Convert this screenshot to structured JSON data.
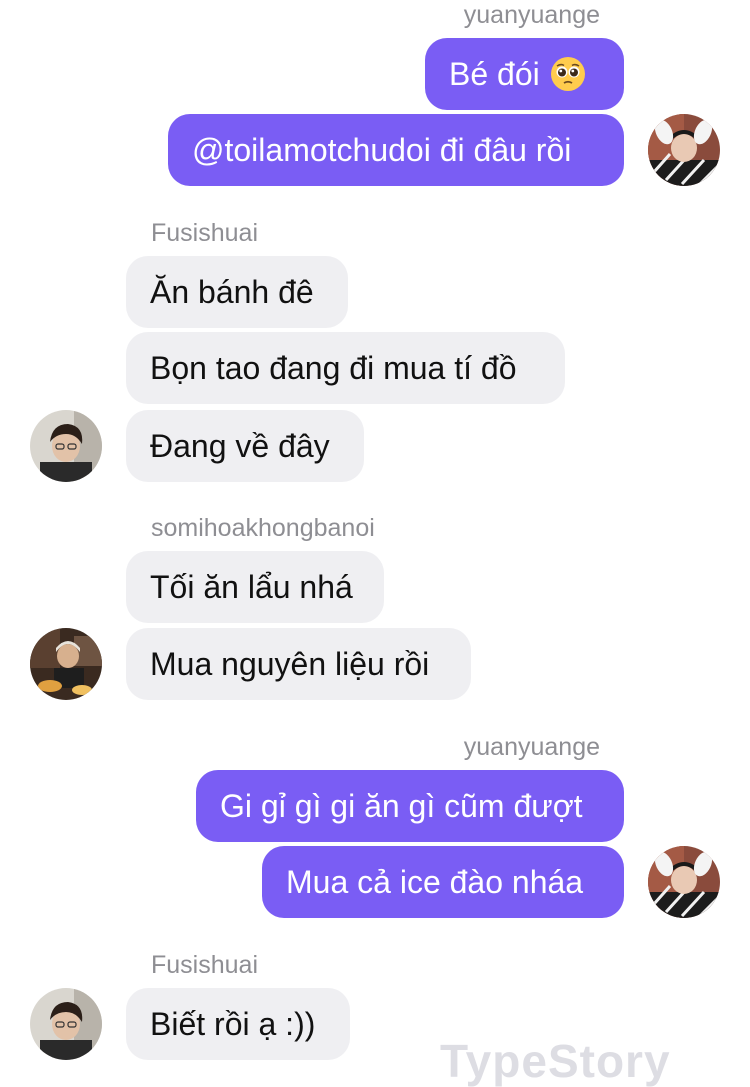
{
  "colors": {
    "outgoing_bubble": "#7a5df4",
    "incoming_bubble": "#efeff2",
    "sender_name": "#8e8e93"
  },
  "groups": [
    {
      "sender": "yuanyuange",
      "direction": "outgoing",
      "messages": [
        "Bé đói",
        "@toilamotchudoi đi đâu rồi"
      ],
      "emoji": "pleading-face"
    },
    {
      "sender": "Fusishuai",
      "direction": "incoming",
      "messages": [
        "Ăn bánh đê",
        "Bọn tao đang đi mua tí đồ",
        "Đang về đây"
      ]
    },
    {
      "sender": "somihoakhongbanoi",
      "direction": "incoming",
      "messages": [
        "Tối ăn lẩu nhá",
        "Mua nguyên liệu rồi"
      ]
    },
    {
      "sender": "yuanyuange",
      "direction": "outgoing",
      "messages": [
        "Gi gỉ gì gi ăn gì cũm đượt",
        "Mua cả ice đào nháa"
      ]
    },
    {
      "sender": "Fusishuai",
      "direction": "incoming",
      "messages": [
        "Biết rồi ạ :))"
      ]
    }
  ],
  "watermark": "TypeStory"
}
